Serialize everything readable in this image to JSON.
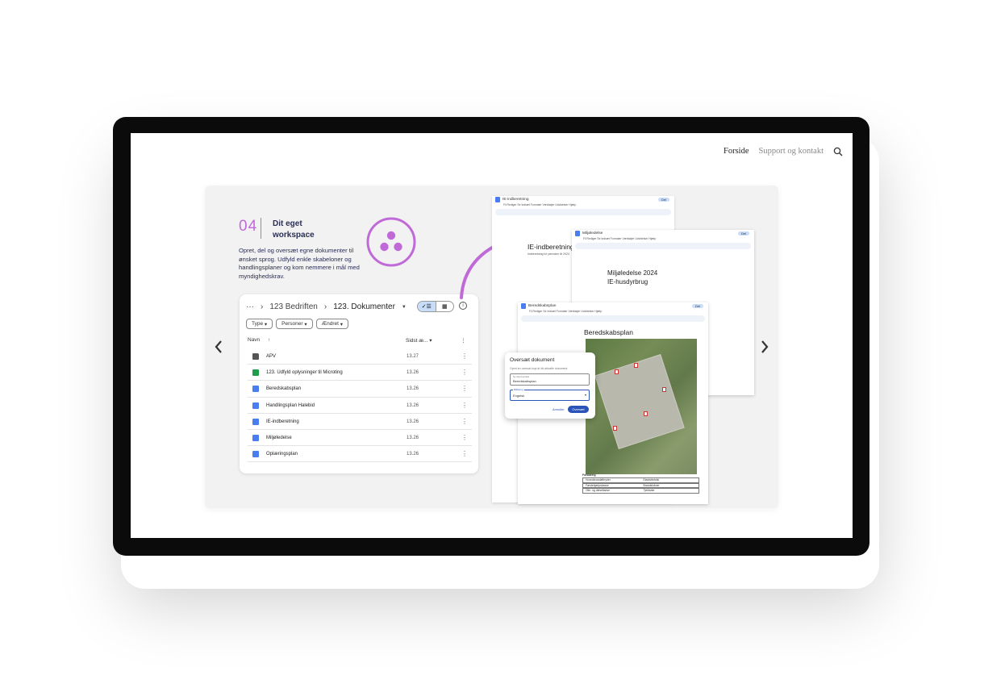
{
  "nav": {
    "home": "Forside",
    "support": "Support og kontakt"
  },
  "slide": {
    "number": "04",
    "title": "Dit eget workspace",
    "description": "Opret, del og oversæt egne dokumenter til ønsket sprog. Udfyld enkle skabeloner og handlingsplaner og kom nemmere i mål med myndighedskrav."
  },
  "drive": {
    "breadcrumb": [
      "123 Bedriften",
      "123. Dokumenter"
    ],
    "filters": [
      "Type",
      "Personer",
      "Ændret"
    ],
    "columns": {
      "name": "Navn",
      "modified": "Sidst æ..."
    },
    "rows": [
      {
        "name": "APV",
        "date": "13.27",
        "type": "folder"
      },
      {
        "name": "123. Udfyld oplysninger til Microting",
        "date": "13.26",
        "type": "sheet"
      },
      {
        "name": "Beredskabsplan",
        "date": "13.26",
        "type": "doc"
      },
      {
        "name": "Handlingsplan Halebid",
        "date": "13.26",
        "type": "doc"
      },
      {
        "name": "IE-indberetning",
        "date": "13.26",
        "type": "doc"
      },
      {
        "name": "Miljøledelse",
        "date": "13.26",
        "type": "doc"
      },
      {
        "name": "Oplæringsplan",
        "date": "13.26",
        "type": "doc"
      }
    ]
  },
  "docs": {
    "ie": {
      "tab": "IE-indberetning",
      "title": "IE-indberetning",
      "subtitle": "Indberetning for perioden år 2024"
    },
    "miljo": {
      "tab": "Miljøledelse",
      "title": "Miljøledelse 2024",
      "subtitle": "IE-husdyrbrug"
    },
    "bered": {
      "tab": "Beredskabsplan",
      "title": "Beredskabsplan",
      "legend_title": "Forklaring",
      "legend": [
        [
          "Hovedbrandafbryder",
          "Elasticitetsfsi"
        ],
        [
          "Førstehjælpskasse",
          "Brandslukner"
        ],
        [
          "Olie- og dieseltanke",
          "Tjekfarke"
        ]
      ]
    },
    "menu": [
      "Fil",
      "Rediger",
      "Se",
      "Indsæt",
      "Formater",
      "Værktøjer",
      "Udvidelser",
      "Hjælp"
    ],
    "share": "Del"
  },
  "dialog": {
    "title": "Oversæt dokument",
    "subtitle": "Opret en oversat kopi af dit aktuelle dokument",
    "field1_label": "Ny dokumentitel",
    "field1_value": "Beredskabsplan",
    "field2_label": "Målsprog",
    "field2_value": "Engelsk",
    "cancel": "Annuller",
    "ok": "Oversæt"
  },
  "colors": {
    "accent": "#c06ad8",
    "title": "#2a2f55",
    "device": "#0b0b0b"
  }
}
